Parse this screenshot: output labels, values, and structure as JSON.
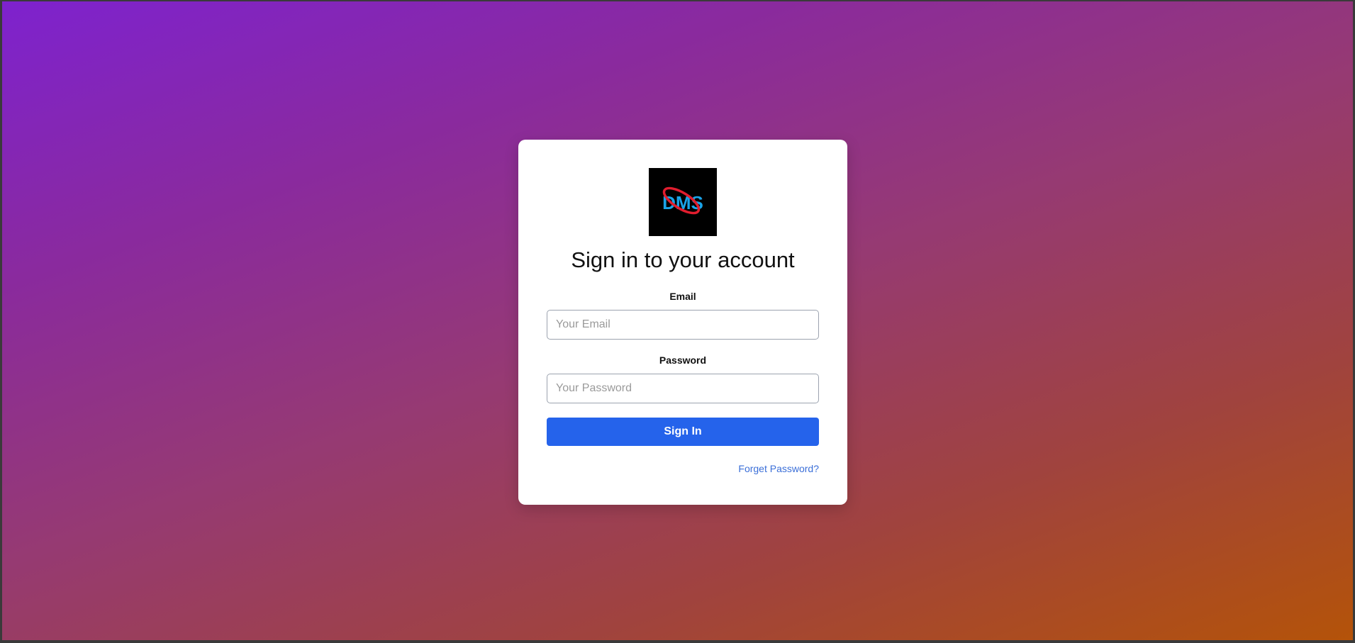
{
  "login": {
    "logo_text": "DMS",
    "title": "Sign in to your account",
    "email_label": "Email",
    "email_placeholder": "Your Email",
    "email_value": "",
    "password_label": "Password",
    "password_placeholder": "Your Password",
    "password_value": "",
    "sign_in_label": "Sign In",
    "forgot_label": "Forget Password?"
  },
  "colors": {
    "primary": "#2563eb",
    "link": "#3b6fd8",
    "logo_blue": "#1aa3e8",
    "logo_red": "#e11d2e",
    "gradient_start": "#7e22ce",
    "gradient_end": "#b45309"
  }
}
